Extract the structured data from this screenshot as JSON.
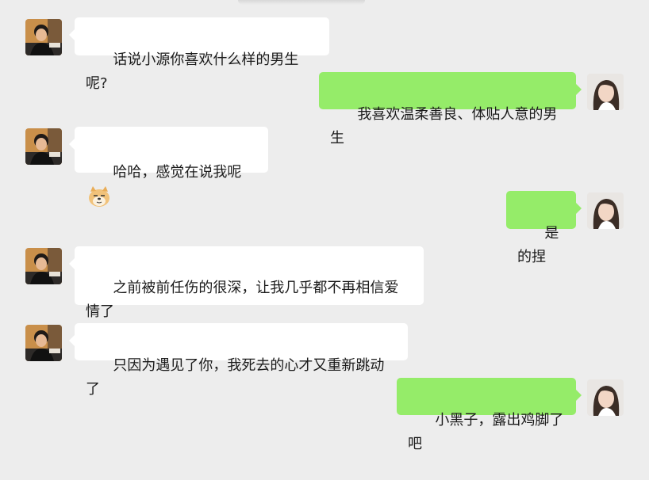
{
  "colors": {
    "background": "#ededed",
    "incoming_bubble": "#ffffff",
    "outgoing_bubble": "#95ec69"
  },
  "messages": [
    {
      "side": "left",
      "text": "话说小源你喜欢什么样的男生呢?"
    },
    {
      "side": "right",
      "text": "我喜欢温柔善良、体贴人意的男生"
    },
    {
      "side": "left",
      "text": "哈哈，感觉在说我呢",
      "emoji": "doge-emoji"
    },
    {
      "side": "right",
      "text": "是的捏"
    },
    {
      "side": "left",
      "text": "之前被前任伤的很深，让我几乎都不再相信爱情了"
    },
    {
      "side": "left",
      "text": "只因为遇见了你，我死去的心才又重新跳动了"
    },
    {
      "side": "right",
      "text": "小黑子，露出鸡脚了吧"
    }
  ]
}
